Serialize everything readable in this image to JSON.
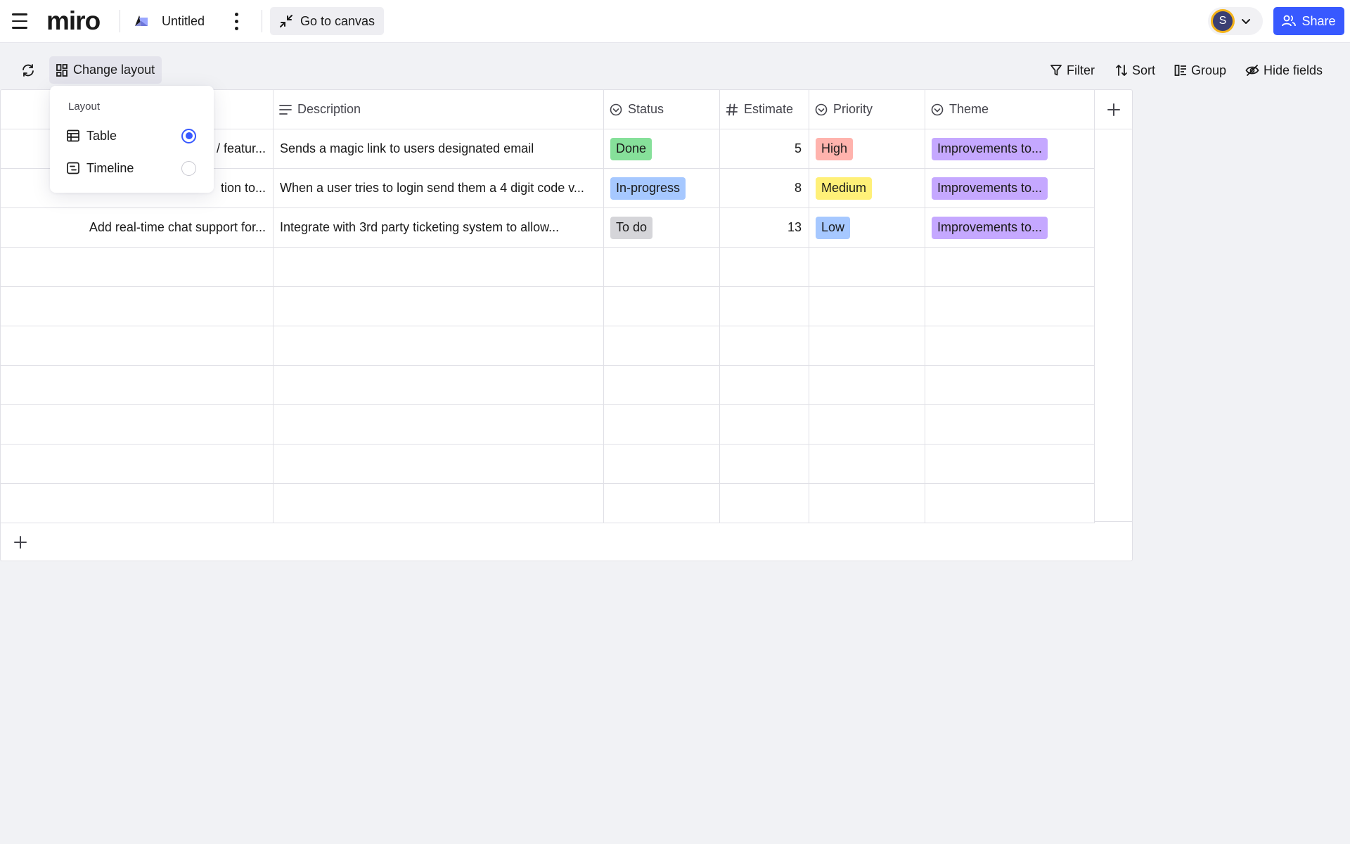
{
  "app": {
    "logo": "miro",
    "board_title": "Untitled"
  },
  "topbar": {
    "goto_canvas": "Go to canvas",
    "avatar_initial": "S",
    "share": "Share"
  },
  "toolbar": {
    "change_layout": "Change layout",
    "filter": "Filter",
    "sort": "Sort",
    "group": "Group",
    "hide_fields": "Hide fields"
  },
  "columns": {
    "description": "Description",
    "status": "Status",
    "estimate": "Estimate",
    "priority": "Priority",
    "theme": "Theme"
  },
  "rows": [
    {
      "title": "/ featur...",
      "description": "Sends a magic link to users designated email",
      "status": "Done",
      "estimate": "5",
      "priority": "High",
      "theme": "Improvements to..."
    },
    {
      "title": "tion to...",
      "description": "When a user tries to login send them a 4 digit code v...",
      "status": "In-progress",
      "estimate": "8",
      "priority": "Medium",
      "theme": "Improvements to..."
    },
    {
      "title": "Add real-time chat support for...",
      "description": "Integrate with 3rd party ticketing system to allow...",
      "status": "To do",
      "estimate": "13",
      "priority": "Low",
      "theme": "Improvements to..."
    }
  ],
  "layout_menu": {
    "label": "Layout",
    "options": [
      {
        "label": "Table",
        "selected": true
      },
      {
        "label": "Timeline",
        "selected": false
      }
    ]
  },
  "colors": {
    "accent": "#3859ff",
    "status_done": "#86e09a",
    "status_in_progress": "#a6c8ff",
    "status_todo": "#d5d5d9",
    "priority_high": "#ffb3ad",
    "priority_medium": "#fff078",
    "priority_low": "#a6c8ff",
    "theme_tag": "#c5a8ff"
  },
  "icons": [
    "menu-icon",
    "board-icon",
    "more-vertical-icon",
    "collapse-icon",
    "chevron-down-icon",
    "users-icon",
    "sync-icon",
    "layout-grid-icon",
    "filter-icon",
    "sort-icon",
    "group-icon",
    "eye-off-icon",
    "text-lines-icon",
    "circle-check-icon",
    "hash-icon",
    "plus-icon",
    "table-icon",
    "timeline-icon"
  ]
}
